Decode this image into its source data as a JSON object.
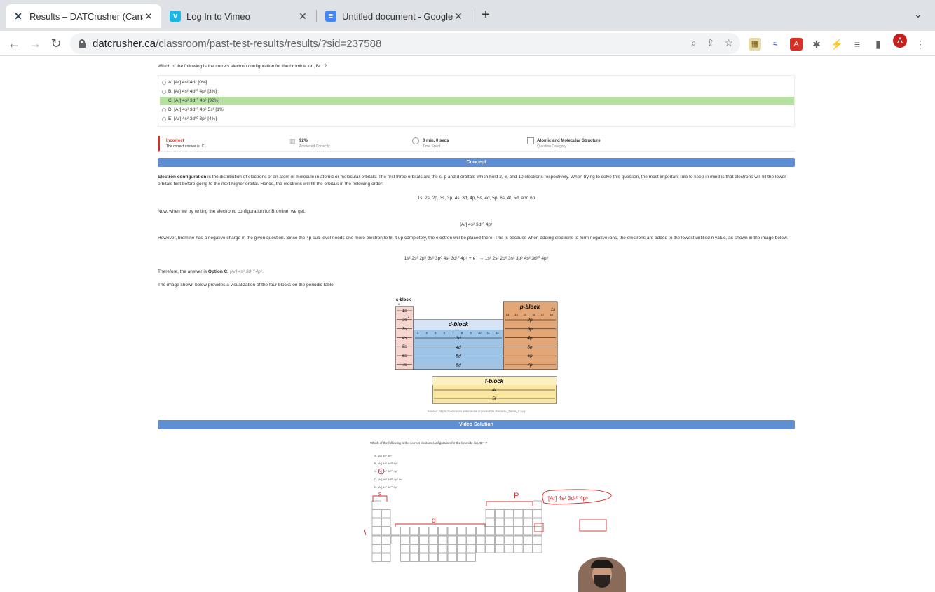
{
  "tabs": [
    {
      "title": "Results – DATCrusher (Canada)",
      "icon": "datcrusher-icon",
      "active": true
    },
    {
      "title": "Log In to Vimeo",
      "icon": "vimeo-icon",
      "active": false
    },
    {
      "title": "Untitled document - Google Docs",
      "icon": "google-docs-icon",
      "active": false
    }
  ],
  "address": {
    "domain": "datcrusher.ca",
    "path": "/classroom/past-test-results/results/?sid=237588"
  },
  "question": "Which of the following is the correct electron configuration for the bromide ion, Br⁻ ?",
  "options": [
    {
      "label": "A. [Ar] 4s² 4d⁵ [0%]",
      "correct": false
    },
    {
      "label": "B. [Ar] 4s² 4d¹⁰ 4p⁶ [3%]",
      "correct": false
    },
    {
      "label": "C. [Ar] 4s² 3d¹⁰ 4p⁶ [92%]",
      "correct": true
    },
    {
      "label": "D. [Ar] 4s² 3d¹⁰ 4p⁶ 5s¹ [1%]",
      "correct": false
    },
    {
      "label": "E. [Ar] 4s² 3d¹⁰ 3p⁶ [4%]",
      "correct": false
    }
  ],
  "result": {
    "status": "Incorrect",
    "answer_note": "The correct answer is: C.",
    "percent": "92%",
    "percent_label": "Answered Correctly",
    "time": "0 min, 0 secs",
    "time_label": "Time Spent",
    "category": "Atomic and Molecular Structure",
    "category_label": "Question Category"
  },
  "concept_header": "Concept",
  "concept": {
    "p1_bold": "Electron configuration",
    "p1": " is the distribution of electrons of an atom or molecule in atomic or molecular orbitals. The first three orbitals are the s, p and d orbitals which hold 2, 6, and 10 electrons respectively. When trying to solve this question, the most important rule to keep in mind is that electrons will fill the lower orbitals first before going to the next higher orbital. Hence, the electrons will fill the orbitals in the following order:",
    "order": "1s, 2s, 2p, 3s, 3p, 4s, 3d, 4p, 5s, 4d, 5p, 6s, 4f, 5d, and 6p",
    "p2": "Now, when we try writing the electronic configuration for Bromine, we get:",
    "br_config": "[Ar] 4s² 3d¹⁰ 4p⁵",
    "p3": "However, bromine has a negative charge in the given question. Since the 4p sub-level needs one more electron to fill it up completely, the electron will be placed there. This is because when adding electrons to form negative ions, the electrons are added to the lowest unfilled n value, as shown in the image below.",
    "equation": "1s² 2s² 2p⁶ 3s² 3p⁶ 4s² 3d¹⁰ 4p⁵ + e⁻ → 1s² 2s² 2p⁶ 3s² 3p⁶ 4s² 3d¹⁰ 4p⁶",
    "p4_pre": "Therefore, the answer is ",
    "p4_bold": "Option C.",
    "p4_italic": " [Ar] 4s² 3d¹⁰ 4p⁶.",
    "p5": "The image shown below provides a visualization of the four blocks on the periodic table:",
    "source": "Source: https://commons.wikimedia.org/wiki/File:Periodic_Table_2.svg"
  },
  "figure": {
    "s_block": "s-block",
    "p_block": "p-block",
    "d_block": "d-block",
    "f_block": "f-block",
    "s_rows": [
      "1s",
      "2s",
      "3s",
      "4s",
      "5s",
      "6s",
      "7s"
    ],
    "p_rows": [
      "2p",
      "3p",
      "4p",
      "5p",
      "6p",
      "7p"
    ],
    "d_rows": [
      "3d",
      "4d",
      "5d",
      "6d"
    ],
    "f_rows": [
      "4f",
      "5f"
    ],
    "he": "1s",
    "cols_s": [
      "1",
      "2"
    ],
    "cols_d": [
      "3",
      "4",
      "5",
      "6",
      "7",
      "8",
      "9",
      "10",
      "11",
      "12"
    ],
    "cols_p": [
      "13",
      "14",
      "15",
      "16",
      "17",
      "18"
    ]
  },
  "video_header": "Video Solution",
  "video": {
    "question": "Which of the following is the correct electron configuration for the bromide ion, Br⁻ ?",
    "opts": [
      "A. [Ar] 4s² 4d⁵",
      "B. [Ar] 4s² 4d¹⁰ 4p⁶",
      "C. [Ar] 4s² 3d¹⁰ 4p⁶",
      "D. [Ar] 4s² 3d¹⁰ 4p⁶ 5s¹",
      "E. [Ar] 4s² 3d¹⁰ 3p⁶"
    ],
    "handwriting": "[Ar] 4s² 3d¹⁰ 4p⁶"
  }
}
